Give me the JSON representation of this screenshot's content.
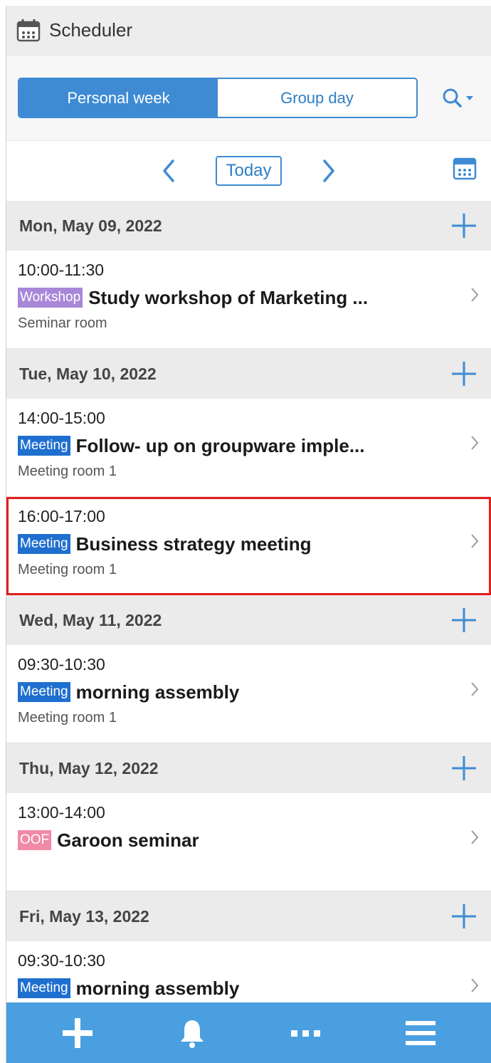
{
  "app": {
    "title": "Scheduler"
  },
  "tabs": [
    {
      "label": "Personal week",
      "active": true
    },
    {
      "label": "Group day",
      "active": false
    }
  ],
  "nav": {
    "today_label": "Today"
  },
  "colors": {
    "accent": "#3e8bd4",
    "workshop": "#a987d8",
    "meeting": "#1f6fcf",
    "oof": "#f08aa6",
    "highlight": "#e41c1c"
  },
  "days": [
    {
      "date": "Mon, May 09, 2022",
      "events": [
        {
          "time": "10:00-11:30",
          "tag": "Workshop",
          "tag_type": "workshop",
          "title": "Study workshop of Marketing ...",
          "location": "Seminar room"
        }
      ]
    },
    {
      "date": "Tue, May 10, 2022",
      "events": [
        {
          "time": "14:00-15:00",
          "tag": "Meeting",
          "tag_type": "meeting",
          "title": "Follow- up on groupware imple...",
          "location": "Meeting room 1"
        },
        {
          "time": "16:00-17:00",
          "tag": "Meeting",
          "tag_type": "meeting",
          "title": "Business strategy meeting",
          "location": "Meeting room 1",
          "selected": true
        }
      ]
    },
    {
      "date": "Wed, May 11, 2022",
      "events": [
        {
          "time": "09:30-10:30",
          "tag": "Meeting",
          "tag_type": "meeting",
          "title": "morning assembly",
          "location": "Meeting room 1"
        }
      ]
    },
    {
      "date": "Thu, May 12, 2022",
      "events": [
        {
          "time": "13:00-14:00",
          "tag": "OOF",
          "tag_type": "oof",
          "title": "Garoon seminar",
          "location": ""
        }
      ]
    },
    {
      "date": "Fri, May 13, 2022",
      "events": [
        {
          "time": "09:30-10:30",
          "tag": "Meeting",
          "tag_type": "meeting",
          "title": "morning assembly",
          "location": ""
        }
      ]
    }
  ],
  "bottom_bar": [
    "add-icon",
    "bell-icon",
    "more-icon",
    "menu-icon"
  ]
}
